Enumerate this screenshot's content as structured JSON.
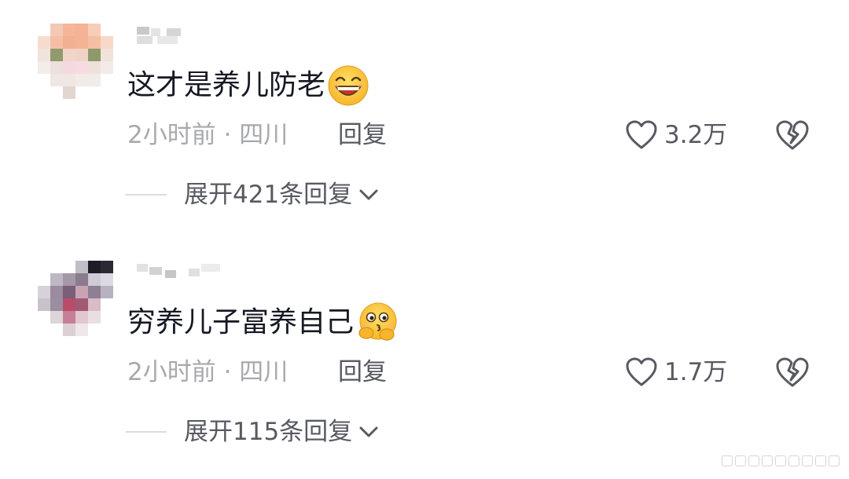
{
  "comments": [
    {
      "content": "这才是养儿防老",
      "emoji": "grinning-face-emoji",
      "meta": "2小时前 · 四川",
      "reply_label": "回复",
      "like_count": "3.2万",
      "expand_label": "展开421条回复"
    },
    {
      "content": "穷养儿子富养自己",
      "emoji": "kiss-face-emoji",
      "meta": "2小时前 · 四川",
      "reply_label": "回复",
      "like_count": "1.7万",
      "expand_label": "展开115条回复"
    }
  ],
  "icons": {
    "like": "heart-outline-icon",
    "dislike": "broken-heart-icon",
    "expand": "chevron-down-icon"
  },
  "colors": {
    "text_primary": "#161823",
    "text_secondary": "#585a62",
    "text_muted": "#a8a9ad",
    "divider": "#dcdcde"
  }
}
